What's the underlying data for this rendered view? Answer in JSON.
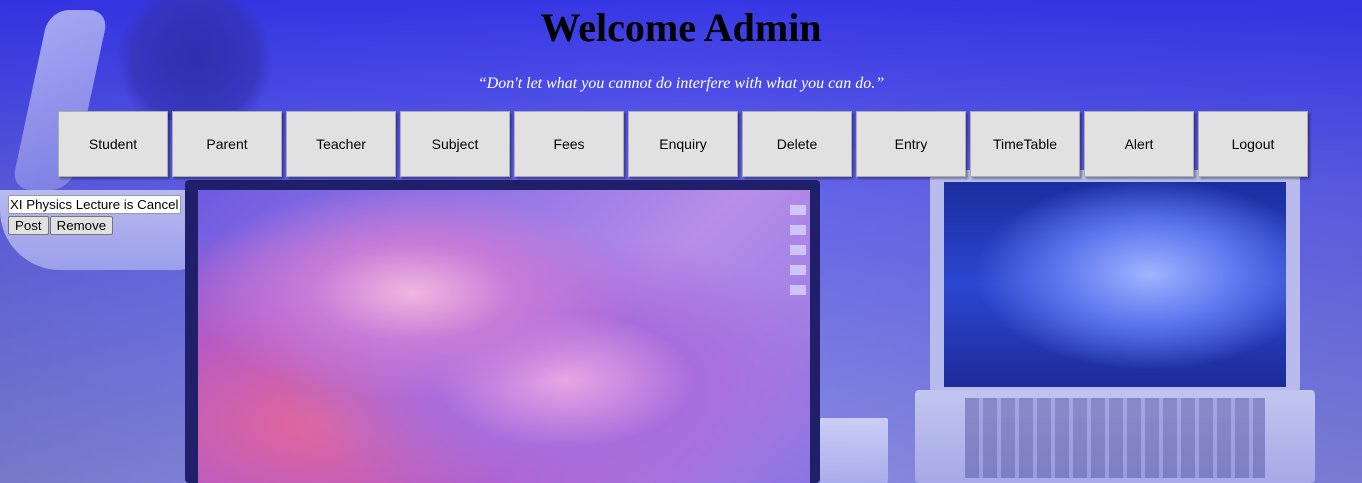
{
  "page": {
    "title": "Welcome Admin",
    "quote": "“Don't let what you cannot do interfere with what you can do.”"
  },
  "nav": {
    "items": [
      {
        "label": "Student"
      },
      {
        "label": "Parent"
      },
      {
        "label": "Teacher"
      },
      {
        "label": "Subject"
      },
      {
        "label": "Fees"
      },
      {
        "label": "Enquiry"
      },
      {
        "label": "Delete"
      },
      {
        "label": "Entry"
      },
      {
        "label": "TimeTable"
      },
      {
        "label": "Alert"
      },
      {
        "label": "Logout"
      }
    ]
  },
  "alert": {
    "input_value": "XI Physics Lecture is Cancel",
    "post_label": "Post",
    "remove_label": "Remove"
  },
  "colors": {
    "overlay": "#3b3bf0",
    "button_bg": "#e1e1e1",
    "quote_text": "#ffffff"
  }
}
